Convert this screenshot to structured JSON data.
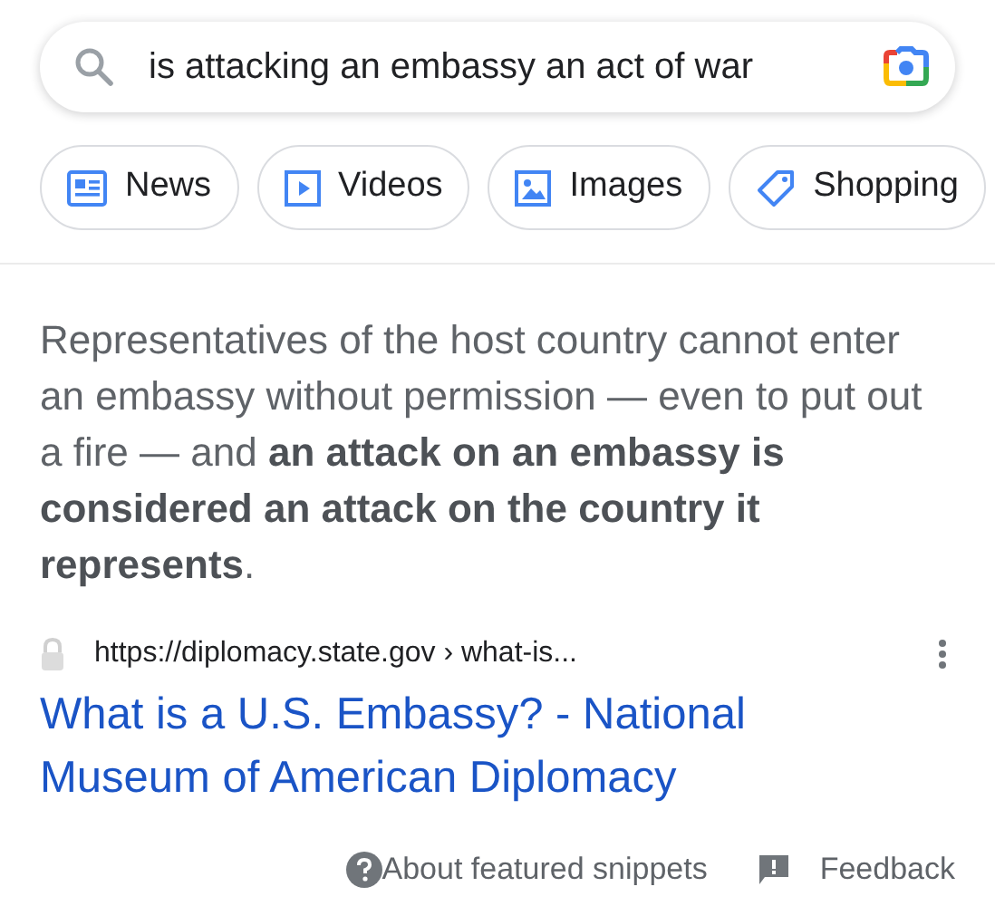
{
  "search": {
    "value": "is attacking an embassy an act of war"
  },
  "chips": [
    {
      "label": "News",
      "kind": "news"
    },
    {
      "label": "Videos",
      "kind": "videos"
    },
    {
      "label": "Images",
      "kind": "images"
    },
    {
      "label": "Shopping",
      "kind": "shopping"
    }
  ],
  "snippet": {
    "text": "Representatives of the host country cannot enter an embassy without permission — even to put out a fire — and **an attack on an embassy is considered an attack on the country it represents**."
  },
  "result": {
    "url": "https://diplomacy.state.gov › what-is...",
    "title": "What is a U.S. Embassy? - National Museum of American Diplomacy"
  },
  "footer": {
    "about": "About featured snippets",
    "feedback": "Feedback"
  }
}
